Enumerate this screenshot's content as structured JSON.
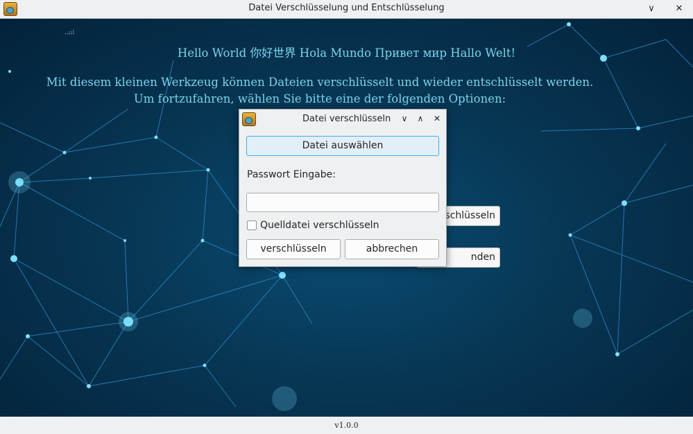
{
  "window": {
    "title": "Datei Verschlüsselung und Entschlüsselung",
    "minimize_glyph": "∨",
    "close_glyph": "✕",
    "app_icon": "lock-file-icon"
  },
  "main": {
    "headline": "Hello World 你好世界 Hola Mundo Привет мир Hallo Welt!",
    "description_line1": "Mit diesem kleinen Werkzeug können Dateien verschlüsselt und wieder entschlüsselt werden.",
    "description_line2": "Um fortzufahren, wählen Sie bitte eine der folgenden Optionen:",
    "partial_button_1": "schlüsseln",
    "partial_button_2": "nden"
  },
  "dialog": {
    "title": "Datei verschlüsseln",
    "icon": "lock-file-icon",
    "minimize_glyph": "∨",
    "maximize_glyph": "∧",
    "close_glyph": "✕",
    "select_file_button": "Datei auswählen",
    "password_label": "Passwort Eingabe:",
    "password_value": "",
    "checkbox_label": "Quelldatei verschlüsseln",
    "checkbox_checked": false,
    "encrypt_button": "verschlüsseln",
    "cancel_button": "abbrechen"
  },
  "statusbar": {
    "version": "v1.0.0"
  },
  "colors": {
    "accent": "#3daee9",
    "headline_text": "#7ad4ec",
    "background_dark": "#04223a"
  }
}
